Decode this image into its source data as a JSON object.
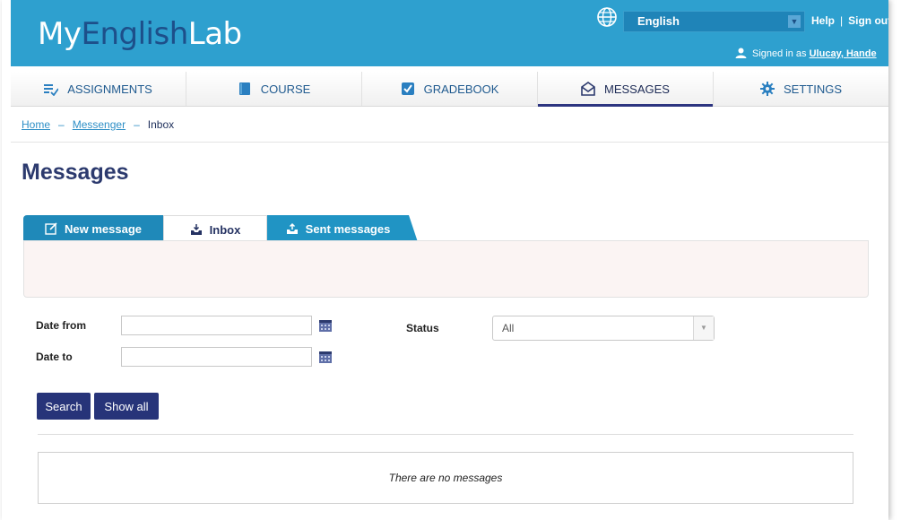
{
  "header": {
    "logo_my": "My",
    "logo_english": "English",
    "logo_lab": "Lab",
    "language": "English",
    "help": "Help",
    "separator": "|",
    "signout": "Sign out",
    "signed_in_prefix": "Signed in as",
    "user_name": "Ulucay, Hande"
  },
  "nav": {
    "items": [
      {
        "label": "ASSIGNMENTS",
        "icon": "assignments-icon"
      },
      {
        "label": "COURSE",
        "icon": "book-icon"
      },
      {
        "label": "GRADEBOOK",
        "icon": "checkbox-icon"
      },
      {
        "label": "MESSAGES",
        "icon": "envelope-icon"
      },
      {
        "label": "SETTINGS",
        "icon": "gear-icon"
      }
    ],
    "active": "MESSAGES"
  },
  "breadcrumb": {
    "home": "Home",
    "messenger": "Messenger",
    "current": "Inbox"
  },
  "page": {
    "title": "Messages"
  },
  "tabs": {
    "new_message": "New message",
    "inbox": "Inbox",
    "sent": "Sent messages"
  },
  "filters": {
    "date_from_label": "Date from",
    "date_to_label": "Date to",
    "date_from_value": "",
    "date_to_value": "",
    "status_label": "Status",
    "status_value": "All"
  },
  "buttons": {
    "search": "Search",
    "show_all": "Show all"
  },
  "results": {
    "empty_text": "There are no messages"
  },
  "colors": {
    "header_bg": "#2ea0cf",
    "nav_active": "#2c3480",
    "button_bg": "#273479",
    "tab_bg": "#1f89b9"
  }
}
